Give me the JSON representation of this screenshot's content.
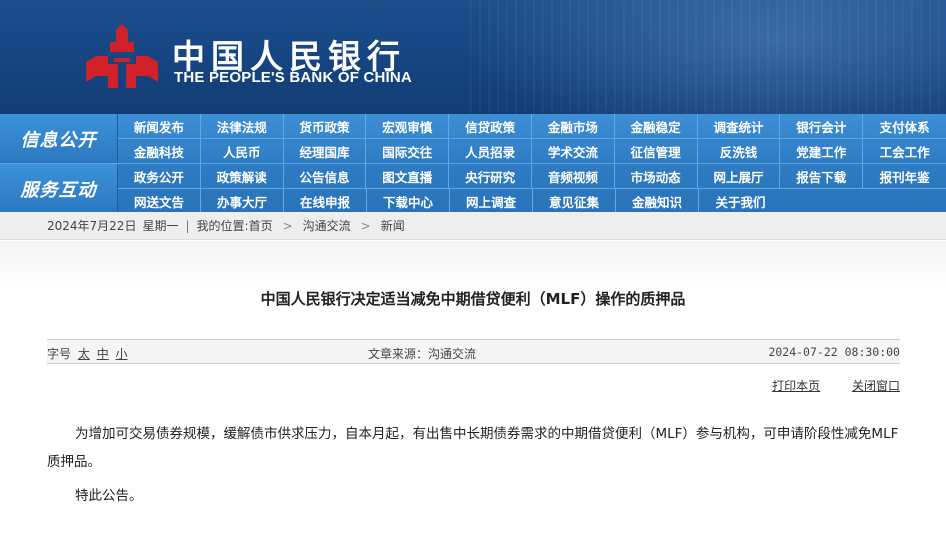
{
  "header": {
    "logo_cn": "中国人民银行",
    "logo_en": "THE PEOPLE'S BANK OF CHINA",
    "brand_color": "#d0202a"
  },
  "nav": {
    "section1": {
      "label": "信息公开",
      "row1": [
        "新闻发布",
        "法律法规",
        "货币政策",
        "宏观审慎",
        "信贷政策",
        "金融市场",
        "金融稳定",
        "调查统计",
        "银行会计",
        "支付体系"
      ],
      "row2": [
        "金融科技",
        "人民币",
        "经理国库",
        "国际交往",
        "人员招录",
        "学术交流",
        "征信管理",
        "反洗钱",
        "党建工作",
        "工会工作"
      ]
    },
    "section2": {
      "label": "服务互动",
      "row1": [
        "政务公开",
        "政策解读",
        "公告信息",
        "图文直播",
        "央行研究",
        "音频视频",
        "市场动态",
        "网上展厅",
        "报告下载",
        "报刊年鉴"
      ],
      "row2": [
        "网送文告",
        "办事大厅",
        "在线申报",
        "下载中心",
        "网上调查",
        "意见征集",
        "金融知识",
        "关于我们"
      ]
    }
  },
  "breadcrumb": {
    "date": "2024年7月22日",
    "weekday": "星期一",
    "location_prefix": "我的位置:",
    "home": "首页",
    "level1": "沟通交流",
    "level2": "新闻"
  },
  "article": {
    "title": "中国人民银行决定适当减免中期借贷便利（MLF）操作的质押品",
    "font_size_label": "字号",
    "font_sizes": [
      "太",
      "中",
      "小"
    ],
    "source_label": "文章来源：",
    "source": "沟通交流",
    "datetime": "2024-07-22 08:30:00",
    "print_label": "打印本页",
    "close_label": "关闭窗口",
    "paragraph1": "为增加可交易债券规模，缓解债市供求压力，自本月起，有出售中长期债券需求的中期借贷便利（MLF）参与机构，可申请阶段性减免MLF质押品。",
    "paragraph2": "特此公告。"
  }
}
